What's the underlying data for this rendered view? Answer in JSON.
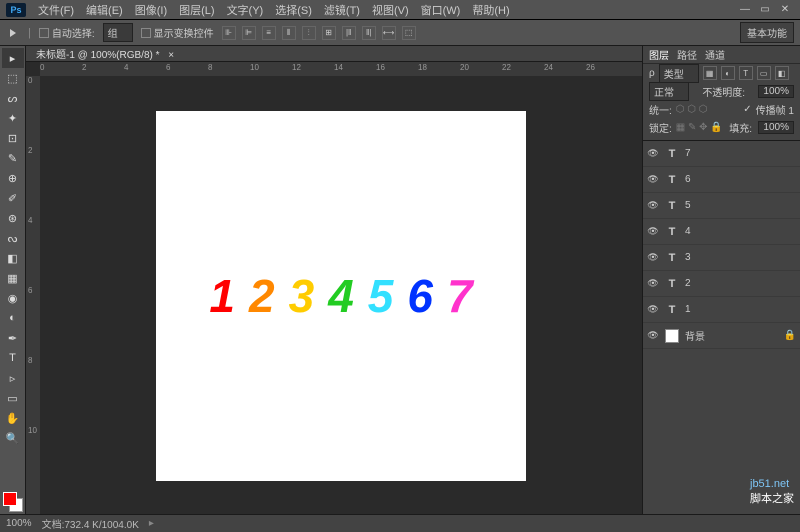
{
  "app": {
    "logo": "Ps"
  },
  "menu": {
    "file": "文件(F)",
    "edit": "编辑(E)",
    "image": "图像(I)",
    "layer": "图层(L)",
    "type": "文字(Y)",
    "select": "选择(S)",
    "filter": "滤镜(T)",
    "view": "视图(V)",
    "window": "窗口(W)",
    "help": "帮助(H)"
  },
  "winctrl": {
    "min": "—",
    "max": "▭",
    "close": "✕"
  },
  "optbar": {
    "auto_select": "自动选择:",
    "group": "组",
    "show_transform": "显示变换控件",
    "essentials": "基本功能"
  },
  "doc": {
    "tab": "未标题-1 @ 100%(RGB/8) *",
    "close": "×"
  },
  "ruler_h": [
    "0",
    "2",
    "4",
    "6",
    "8",
    "10",
    "12",
    "14",
    "16",
    "18",
    "20",
    "22",
    "24",
    "26"
  ],
  "ruler_v": [
    "0",
    "2",
    "4",
    "6",
    "8",
    "10"
  ],
  "numbers": [
    {
      "t": "1",
      "c": "#ff0000"
    },
    {
      "t": "2",
      "c": "#ff8800"
    },
    {
      "t": "3",
      "c": "#ffcc00"
    },
    {
      "t": "4",
      "c": "#22cc22"
    },
    {
      "t": "5",
      "c": "#33e0ff"
    },
    {
      "t": "6",
      "c": "#0033ff"
    },
    {
      "t": "7",
      "c": "#ff33cc"
    }
  ],
  "layer_panel": {
    "tabs": {
      "layers": "图层",
      "paths": "路径",
      "channels": "通道"
    },
    "kind": "类型",
    "mode": "正常",
    "opacity_lbl": "不透明度:",
    "opacity": "100%",
    "unify": "统一:",
    "propagate": "传播帧 1",
    "lock": "锁定:",
    "fill_lbl": "填充:",
    "fill": "100%"
  },
  "layers": [
    {
      "name": "7"
    },
    {
      "name": "6"
    },
    {
      "name": "5"
    },
    {
      "name": "4"
    },
    {
      "name": "3"
    },
    {
      "name": "2"
    },
    {
      "name": "1"
    }
  ],
  "bg_layer": "背景",
  "status": {
    "zoom": "100%",
    "doc": "文档:732.4 K/1004.0K"
  },
  "watermark": {
    "url": "jb51.net",
    "cn": "脚本之家"
  }
}
